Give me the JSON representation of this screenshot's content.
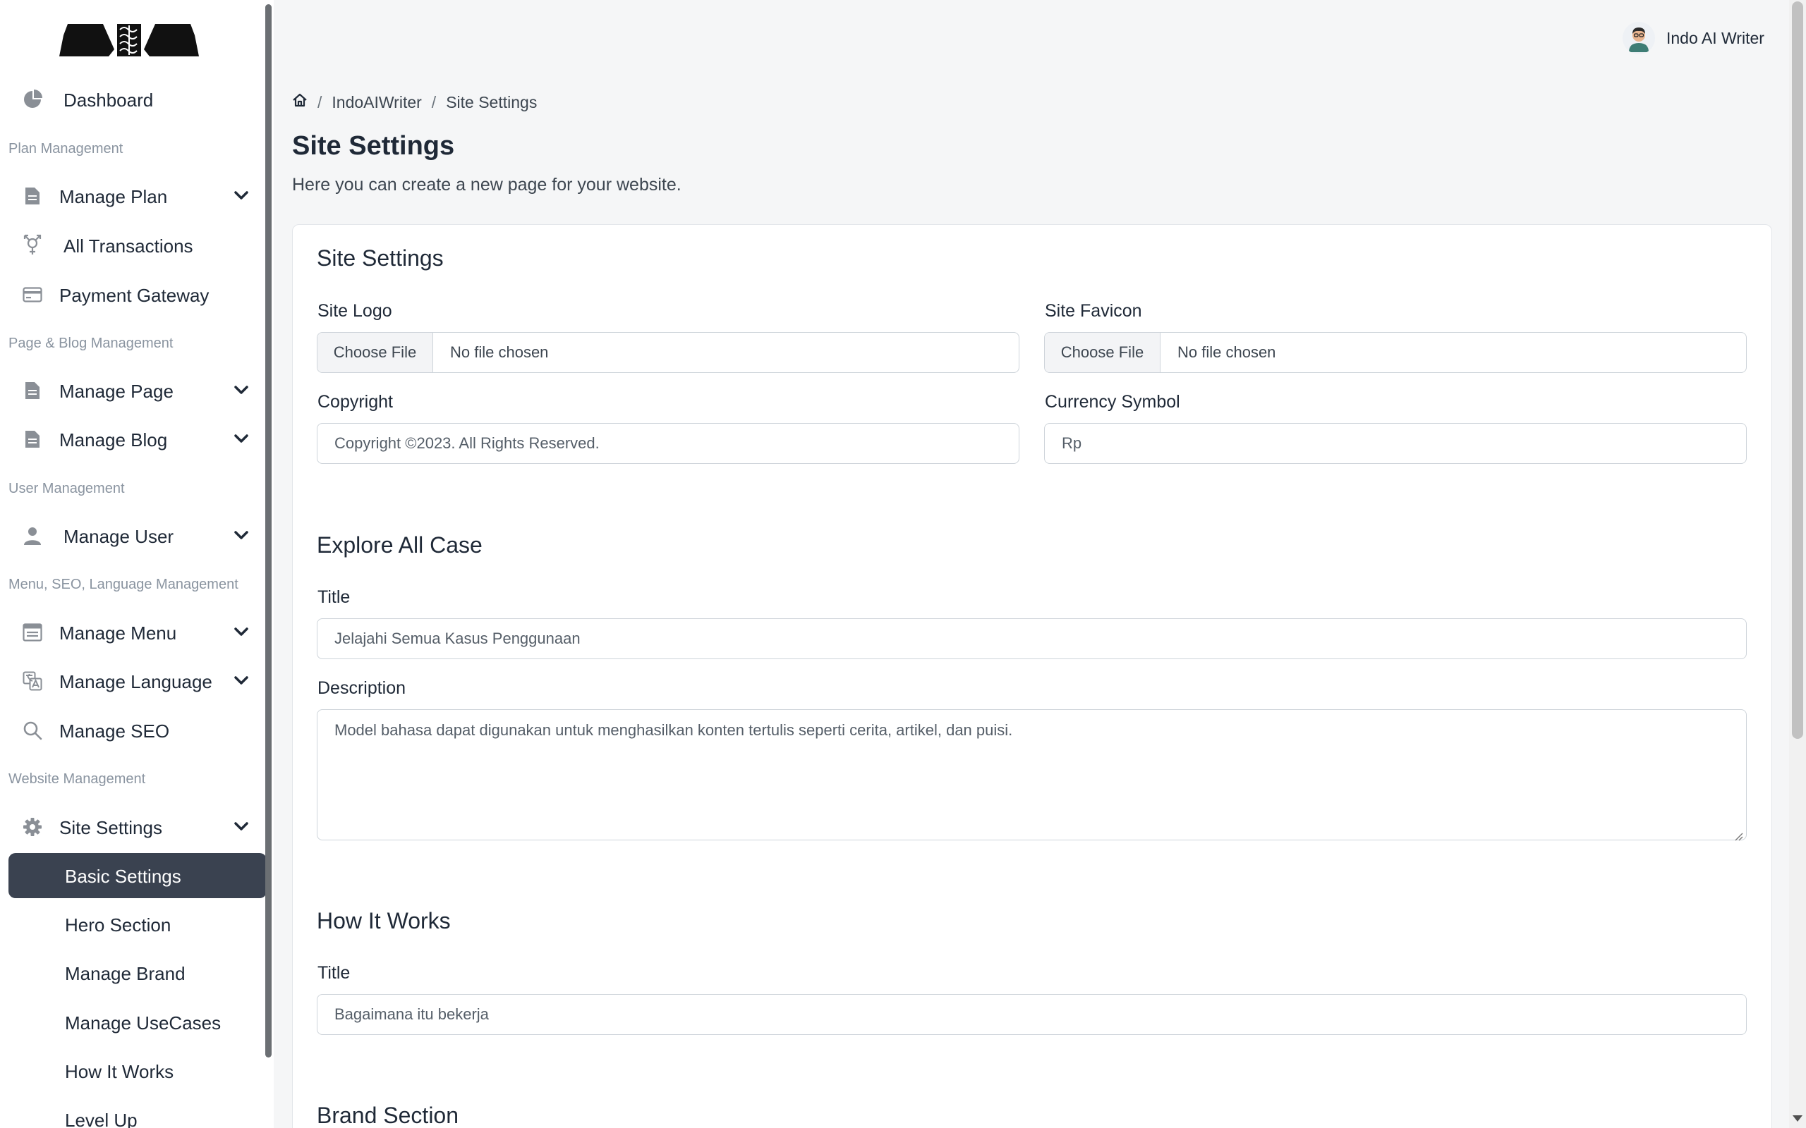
{
  "sidebar": {
    "dashboard": "Dashboard",
    "sections": {
      "plan": "Plan Management",
      "page_blog": "Page & Blog Management",
      "user": "User Management",
      "menu_seo_lang": "Menu, SEO, Language Management",
      "website": "Website Management"
    },
    "items": {
      "manage_plan": "Manage Plan",
      "all_transactions": "All Transactions",
      "payment_gateway": "Payment Gateway",
      "manage_page": "Manage Page",
      "manage_blog": "Manage Blog",
      "manage_user": "Manage User",
      "manage_menu": "Manage Menu",
      "manage_language": "Manage Language",
      "manage_seo": "Manage SEO",
      "site_settings": "Site Settings"
    },
    "sub_items": {
      "basic_settings": "Basic Settings",
      "hero_section": "Hero Section",
      "manage_brand": "Manage Brand",
      "manage_usecases": "Manage UseCases",
      "how_it_works": "How It Works",
      "level_up": "Level Up"
    }
  },
  "header": {
    "user_name": "Indo AI Writer"
  },
  "breadcrumb": {
    "parent": "IndoAIWriter",
    "current": "Site Settings",
    "separator": "/"
  },
  "page": {
    "title": "Site Settings",
    "subtitle": "Here you can create a new page for your website."
  },
  "form": {
    "site_settings": {
      "heading": "Site Settings",
      "site_logo_label": "Site Logo",
      "site_favicon_label": "Site Favicon",
      "choose_file": "Choose File",
      "no_file": "No file chosen",
      "copyright_label": "Copyright",
      "copyright_value": "Copyright ©2023. All Rights Reserved.",
      "currency_label": "Currency Symbol",
      "currency_value": "Rp"
    },
    "explore": {
      "heading": "Explore All Case",
      "title_label": "Title",
      "title_value": "Jelajahi Semua Kasus Penggunaan",
      "description_label": "Description",
      "description_value": "Model bahasa dapat digunakan untuk menghasilkan konten tertulis seperti cerita, artikel, dan puisi."
    },
    "how_it_works": {
      "heading": "How It Works",
      "title_label": "Title",
      "title_value": "Bagaimana itu bekerja"
    },
    "brand": {
      "heading": "Brand Section"
    }
  },
  "colors": {
    "active_bg": "#3a4250",
    "sidebar_bg": "#ffffff",
    "content_bg": "#f5f6f7"
  },
  "icons": {
    "dashboard": "pie-chart-icon",
    "plan": "document-icon",
    "transactions": "transgender-icon",
    "gateway": "credit-card-icon",
    "user": "person-icon",
    "menu": "menu-layout-icon",
    "language": "translate-icon",
    "seo": "search-icon",
    "settings": "gear-icon",
    "chevron": "chevron-down-icon",
    "home": "home-icon"
  }
}
